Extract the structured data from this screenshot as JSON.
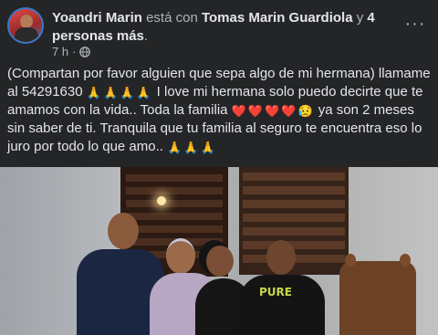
{
  "post": {
    "author": "Yoandri Marin",
    "with_text": "está con",
    "tagged": "Tomas Marin Guardiola",
    "and_text": "y",
    "others": "4 personas más",
    "period": ".",
    "time": "7 h",
    "separator": "·",
    "privacy_icon": "globe-icon",
    "more_label": "···"
  },
  "text": {
    "part1": "(Compartan por favor alguien que sepa algo de mi hermana) llamame al 54291630 ",
    "emoji_pray": "🙏",
    "part2": " I love mi hermana solo puedo decirte que te amamos con la vida.. Toda la familia ",
    "emoji_heart": "❤️",
    "emoji_sad": "😥",
    "part3": " ya son 2 meses sin saber de ti. Tranquila que tu familia al seguro te encuentra eso lo juro por todo lo que amo.. "
  },
  "photo": {
    "shirt_text": "PURE"
  },
  "colors": {
    "background": "#242526",
    "text_primary": "#e4e6eb",
    "text_secondary": "#b0b3b8"
  }
}
